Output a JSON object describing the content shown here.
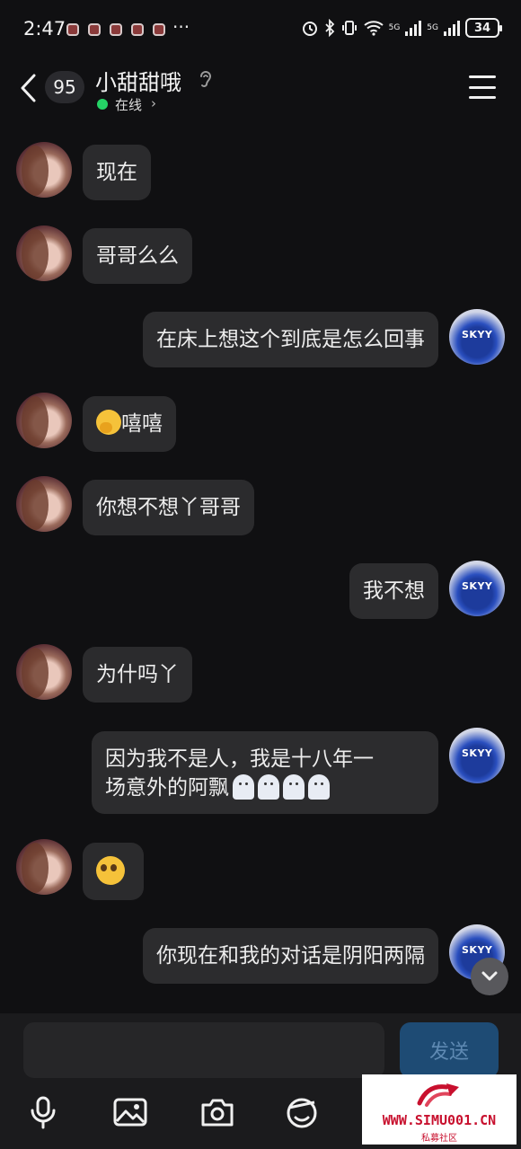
{
  "status_bar": {
    "time": "2:47",
    "more": "···",
    "battery": "34",
    "network_a": "5G",
    "network_b": "5G"
  },
  "header": {
    "unread_count": "95",
    "contact_name": "小甜甜哦",
    "status": "在线",
    "status_chevron": "›"
  },
  "messages": [
    {
      "sender": "them",
      "text": "现在"
    },
    {
      "sender": "them",
      "text": "哥哥么么"
    },
    {
      "sender": "me",
      "text": "在床上想这个到底是怎么回事"
    },
    {
      "sender": "them",
      "text": "嘻嘻",
      "emoji": "shushing-face-emoji"
    },
    {
      "sender": "them",
      "text": "你想不想丫哥哥"
    },
    {
      "sender": "me",
      "text": "我不想"
    },
    {
      "sender": "them",
      "text": "为什吗丫"
    },
    {
      "sender": "me",
      "text_line1": "因为我不是人，我是十八年一",
      "text_line2": "场意外的阿飘",
      "emoji": "ghost-emoji"
    },
    {
      "sender": "them",
      "text": "",
      "emoji": "pleading-face-emoji"
    },
    {
      "sender": "me",
      "text": "你现在和我的对话是阴阳两隔"
    }
  ],
  "input": {
    "send_label": "发送"
  },
  "icons": {
    "back": "chevron-left-icon",
    "listen": "ear-icon",
    "menu": "menu-icon",
    "scroll_down": "chevron-down-icon",
    "mic": "microphone-icon",
    "image": "image-icon",
    "camera": "camera-icon",
    "sticker": "sticker-icon"
  },
  "watermark": {
    "url": "WWW.SIMU001.CN",
    "sub": "私募社区"
  },
  "colors": {
    "background": "#101012",
    "bubble": "#2b2b2d",
    "online": "#25d366",
    "send_button": "#1e4b74"
  }
}
